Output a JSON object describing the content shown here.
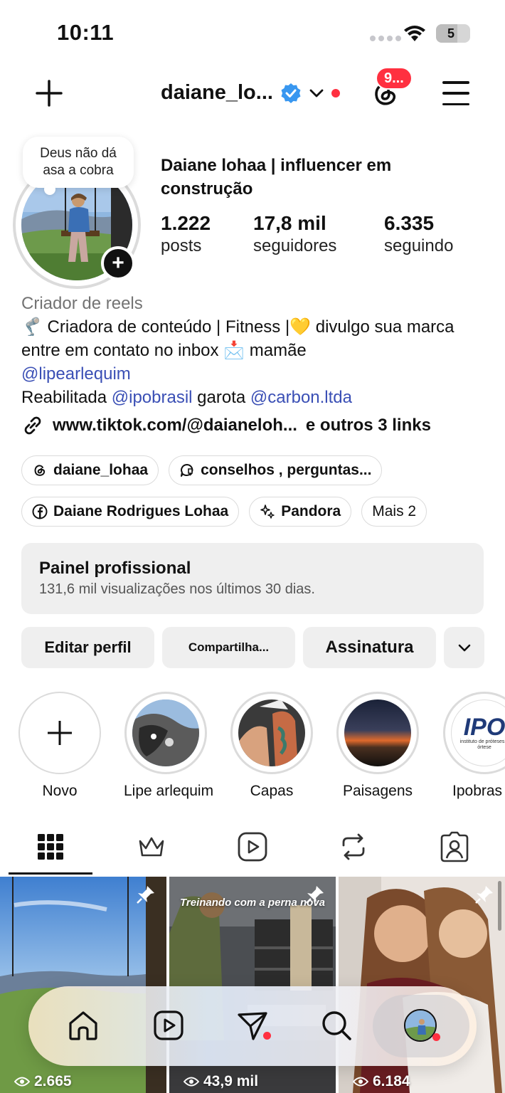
{
  "status_bar": {
    "time": "10:11",
    "battery": "5"
  },
  "header": {
    "username": "daiane_lo...",
    "notifications_badge": "9..."
  },
  "profile": {
    "note": "Deus não dá asa a cobra",
    "display_name": "Daiane lohaa | influencer em construção",
    "stats": [
      {
        "value": "1.222",
        "label": "posts"
      },
      {
        "value": "17,8 mil",
        "label": "seguidores"
      },
      {
        "value": "6.335",
        "label": "seguindo"
      }
    ],
    "category": "Criador de reels",
    "bio": {
      "line1": "🦿 Criadora de conteúdo | Fitness |💛 divulgo sua marca entre em contato  no inbox 📩 mamãe",
      "mention_1": "@lipearlequim",
      "line3_a": "Reabilitada ",
      "mention_2": "@ipobrasil",
      "line3_b": " garota ",
      "mention_3": "@carbon.ltda"
    },
    "link": "www.tiktok.com/@daianeloh...",
    "link_more": "e outros 3 links",
    "chips": [
      {
        "label": "daiane_lohaa",
        "icon": "threads-icon"
      },
      {
        "label": "conselhos , perguntas...",
        "icon": "chat-icon"
      },
      {
        "label": "Daiane Rodrigues Lohaa",
        "icon": "facebook-icon"
      },
      {
        "label": "Pandora",
        "icon": "sparkle-icon"
      },
      {
        "label": "Mais 2"
      }
    ]
  },
  "dashboard": {
    "title": "Painel profissional",
    "subtitle": "131,6 mil visualizações nos últimos 30 dias."
  },
  "buttons": {
    "edit": "Editar perfil",
    "share": "Compartilha...",
    "subscription": "Assinatura"
  },
  "highlights": [
    {
      "label": "Novo"
    },
    {
      "label": "Lipe arlequim"
    },
    {
      "label": "Capas"
    },
    {
      "label": "Paisagens"
    },
    {
      "label": "Ipobras"
    }
  ],
  "highlight_logo_text": "IPO",
  "highlight_logo_sub": "instituto de próteses e órtese",
  "tabs": [
    "grid-icon",
    "crown-icon",
    "reels-icon",
    "repost-icon",
    "tagged-icon"
  ],
  "grid": [
    {
      "views": "2.665",
      "caption": ""
    },
    {
      "views": "43,9 mil",
      "caption": "Treinando com a perna nova"
    },
    {
      "views": "6.184",
      "caption": ""
    }
  ],
  "colors": {
    "accent_red": "#ff3040",
    "verified_blue": "#3897f0",
    "mention_blue": "#3a4fb5"
  }
}
